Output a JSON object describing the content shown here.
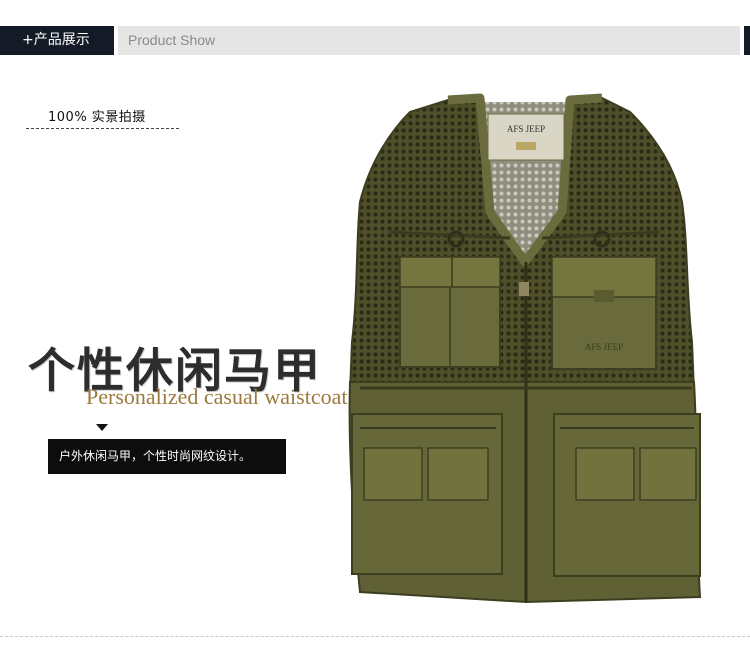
{
  "header": {
    "cn_label": "+产品展示",
    "en_label": "Product Show"
  },
  "photo_tag": "100% 实景拍摄",
  "title": {
    "cn": "个性休闲马甲",
    "en": "Personalized casual waistcoat"
  },
  "description": "户外休闲马甲，个性时尚网纹设计。",
  "product": {
    "label_text": "AFS JEEP",
    "chest_embroidery": "AFS JEEP",
    "color": "#5f6034"
  },
  "colors": {
    "header_dark": "#141b26",
    "header_light": "#e5e5e5",
    "accent_gold": "#9c7a3d"
  }
}
